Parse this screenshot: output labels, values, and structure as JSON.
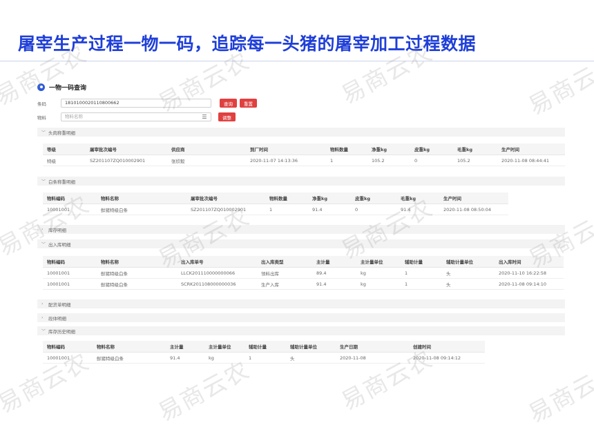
{
  "slide": {
    "title": "屠宰生产过程一物一码，追踪每一头猪的屠宰加工过程数据",
    "watermark": "易商云农"
  },
  "query": {
    "title": "一物一码查询",
    "barcode_label": "条码",
    "barcode_value": "1810100020110800662",
    "material_label": "物料",
    "material_placeholder": "物料名称",
    "search_label": "查询",
    "reset_label": "重置",
    "adjust_label": "调整"
  },
  "sections": {
    "s1": "头肉称重明细",
    "s2": "白条称重明细",
    "s3": "库存明细",
    "s4": "出入库明细",
    "s5": "配货单明细",
    "s6": "段体明细",
    "s7": "库存历史明细"
  },
  "table1": {
    "headers": [
      "等级",
      "屠宰批次编号",
      "供应商",
      "到厂时间",
      "物料数量",
      "净重kg",
      "皮重kg",
      "毛重kg",
      "生产时间"
    ],
    "rows": [
      [
        "特级",
        "SZ20110​7ZQ010002901",
        "张欣毅",
        "2020-11-07 14:13:36",
        "1",
        "105.2",
        "0",
        "105.2",
        "2020-11-08 08:44:41"
      ]
    ]
  },
  "table2": {
    "headers": [
      "物料编码",
      "物料名称",
      "屠宰批次编号",
      "物料数量",
      "净重kg",
      "皮重kg",
      "毛重kg",
      "生产时间"
    ],
    "rows": [
      [
        "10001001",
        "鲜猪特级白条",
        "SZ201107ZQ010002901",
        "1",
        "91.4",
        "0",
        "91.4",
        "2020-11-08 08:50:04"
      ]
    ]
  },
  "table3": {
    "headers": [
      "物料编码",
      "物料名称",
      "出入库单号",
      "出入库类型",
      "主计量",
      "主计量单位",
      "辅助计量",
      "辅助计量单位",
      "出入库时间"
    ],
    "rows": [
      [
        "10001001",
        "鲜猪特级白条",
        "LLCK201110000000066",
        "领料出库",
        "89.4",
        "kg",
        "1",
        "头",
        "2020-11-10 16:22:58"
      ],
      [
        "10001001",
        "鲜猪特级白条",
        "SCRK201108000000036",
        "生产入库",
        "91.4",
        "kg",
        "1",
        "头",
        "2020-11-08 09:14:10"
      ]
    ]
  },
  "table4": {
    "headers": [
      "物料编码",
      "物料名称",
      "主计量",
      "主计量单位",
      "辅助计量",
      "辅助计量单位",
      "生产日期",
      "创建时间"
    ],
    "rows": [
      [
        "10001001",
        "鲜猪特级白条",
        "91.4",
        "kg",
        "1",
        "头",
        "2020-11-08",
        "2020-11-08 09:14:12"
      ]
    ]
  }
}
